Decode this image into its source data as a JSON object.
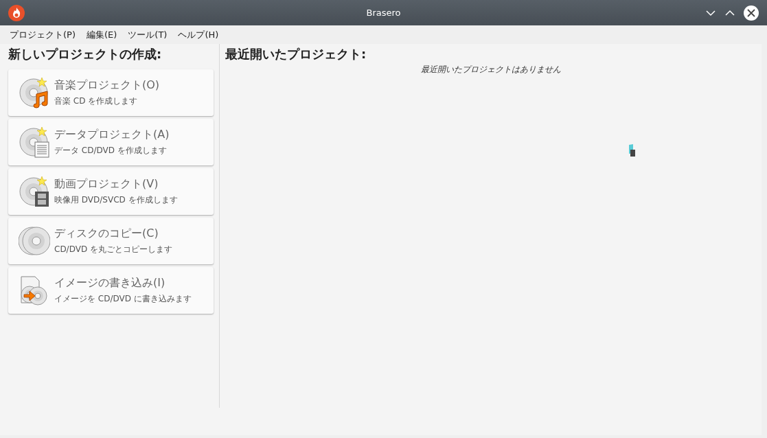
{
  "window": {
    "title": "Brasero"
  },
  "menu": [
    "プロジェクト(P)",
    "編集(E)",
    "ツール(T)",
    "ヘルプ(H)"
  ],
  "new_project": {
    "heading": "新しいプロジェクトの作成:",
    "cards": [
      {
        "kind": "music",
        "title": "音楽プロジェクト(O)",
        "description": "音楽 CD を作成します"
      },
      {
        "kind": "data",
        "title": "データプロジェクト(A)",
        "description": "データ CD/DVD を作成します"
      },
      {
        "kind": "video",
        "title": "動画プロジェクト(V)",
        "description": "映像用 DVD/SVCD を作成します"
      },
      {
        "kind": "copy",
        "title": "ディスクのコピー(C)",
        "description": "CD/DVD を丸ごとコピーします"
      },
      {
        "kind": "image",
        "title": "イメージの書き込み(I)",
        "description": "イメージを CD/DVD に書き込みます"
      }
    ]
  },
  "recent": {
    "heading": "最近開いたプロジェクト:",
    "empty_message": "最近開いたプロジェクトはありません"
  }
}
